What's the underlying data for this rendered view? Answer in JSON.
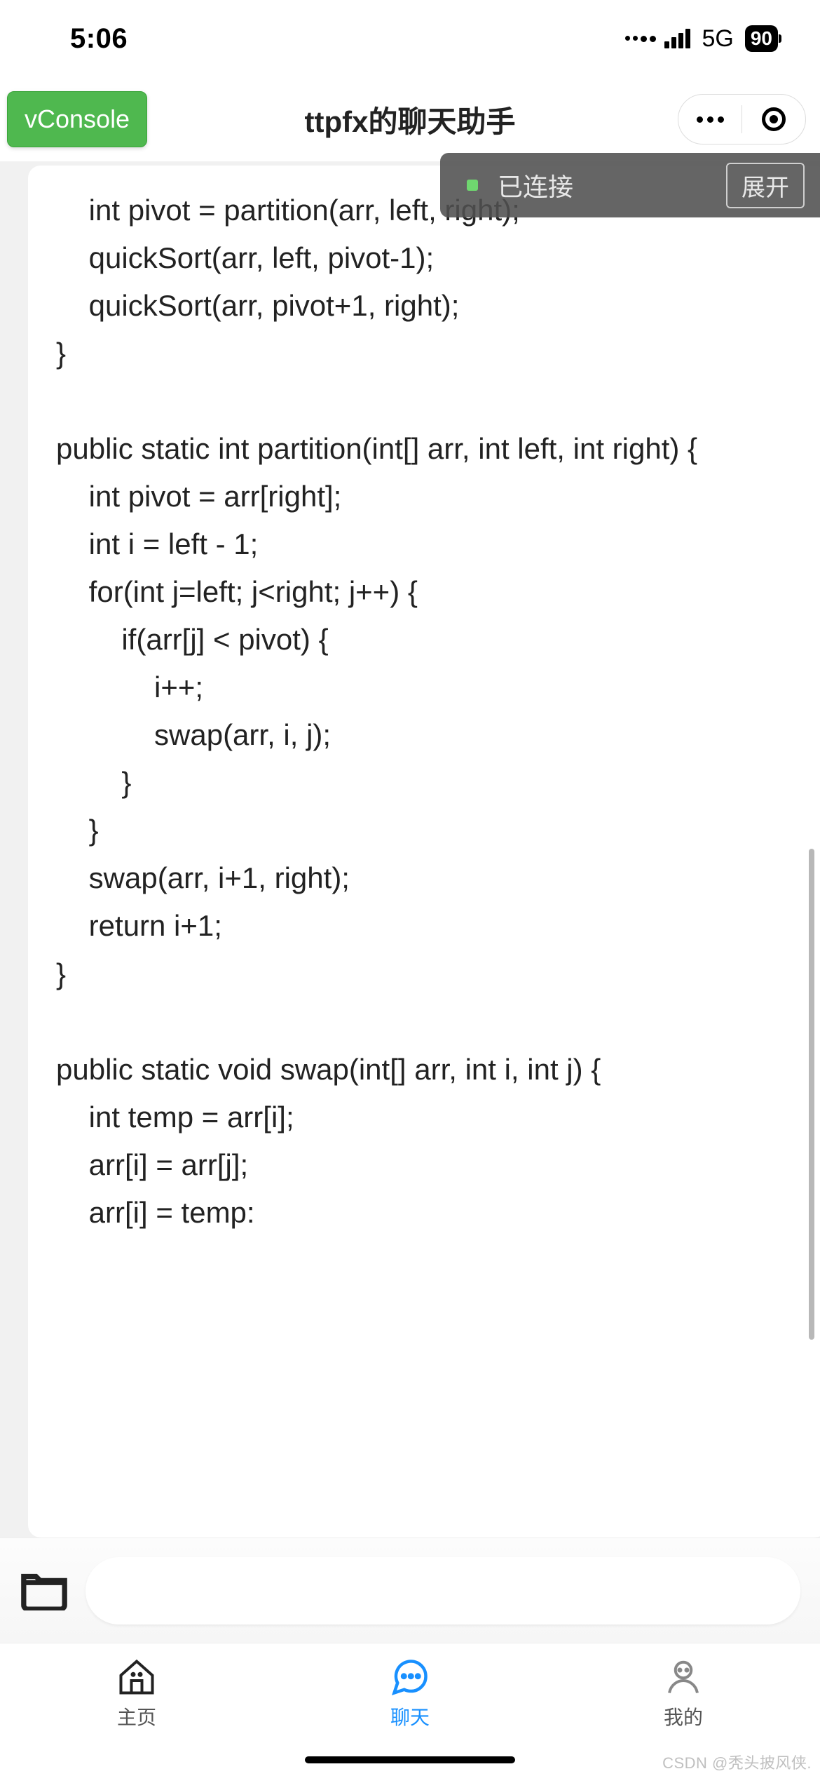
{
  "status": {
    "time": "5:06",
    "network": "5G",
    "battery": "90"
  },
  "nav": {
    "vconsole": "vConsole",
    "title": "ttpfx的聊天助手"
  },
  "banner": {
    "connected": "已连接",
    "expand": "展开"
  },
  "chat": {
    "code": "    int pivot = partition(arr, left, right);\n    quickSort(arr, left, pivot-1);\n    quickSort(arr, pivot+1, right);\n}\n\npublic static int partition(int[] arr, int left, int right) {\n    int pivot = arr[right];\n    int i = left - 1;\n    for(int j=left; j<right; j++) {\n        if(arr[j] < pivot) {\n            i++;\n            swap(arr, i, j);\n        }\n    }\n    swap(arr, i+1, right);\n    return i+1;\n}\n\npublic static void swap(int[] arr, int i, int j) {\n    int temp = arr[i];\n    arr[i] = arr[j];\n    arr[i] = temp:"
  },
  "tabs": {
    "home": "主页",
    "chat": "聊天",
    "mine": "我的"
  },
  "watermark": "CSDN @秃头披风侠."
}
